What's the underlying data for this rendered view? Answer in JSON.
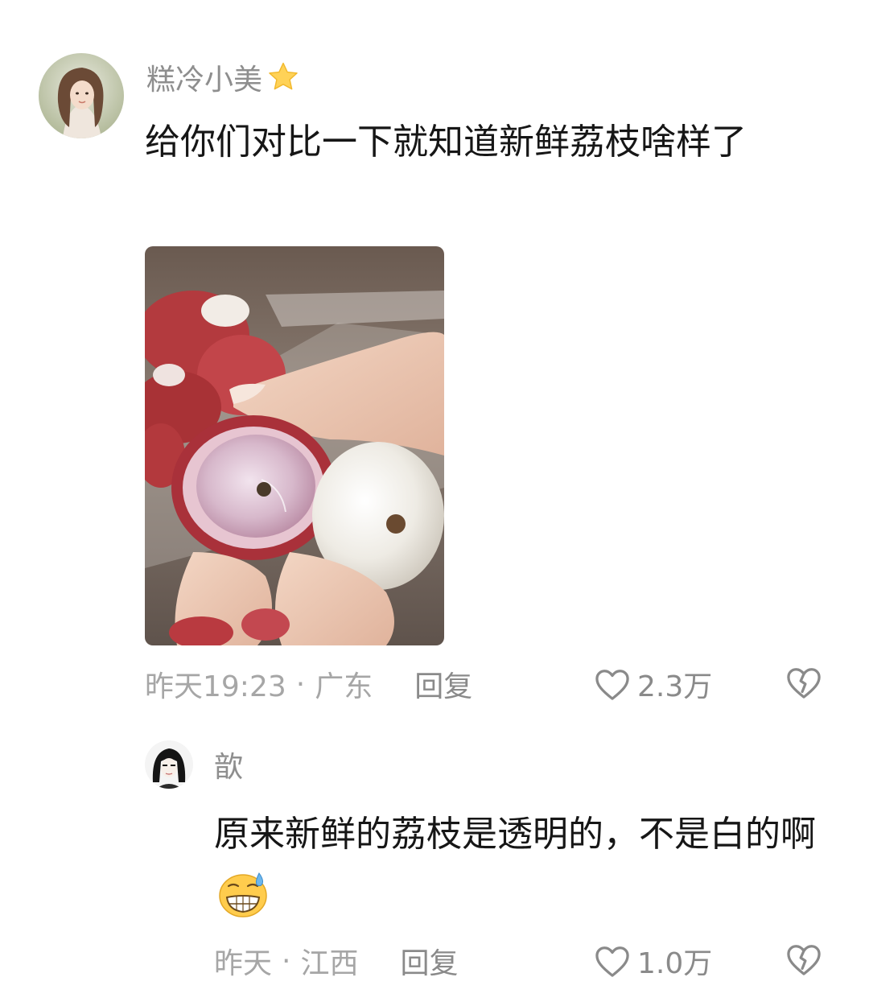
{
  "comment": {
    "username": "糕冷小美",
    "badge_icon": "star-icon",
    "text": "给你们对比一下就知道新鲜荔枝啥样了",
    "image_subject": "lychee-photo",
    "time": "昨天19:23",
    "separator": "·",
    "location": "广东",
    "reply_label": "回复",
    "like_count": "2.3万"
  },
  "reply": {
    "username": "歆",
    "text": "原来新鲜的荔枝是透明的，不是白的啊",
    "emoji_icon": "grinning-sweat-emoji",
    "time": "昨天",
    "separator": "·",
    "location": "江西",
    "reply_label": "回复",
    "like_count": "1.0万"
  },
  "colors": {
    "meta_text": "#a6a6a6",
    "username": "#8e8e8e",
    "body_text": "#161616",
    "star": "#ffd257"
  }
}
